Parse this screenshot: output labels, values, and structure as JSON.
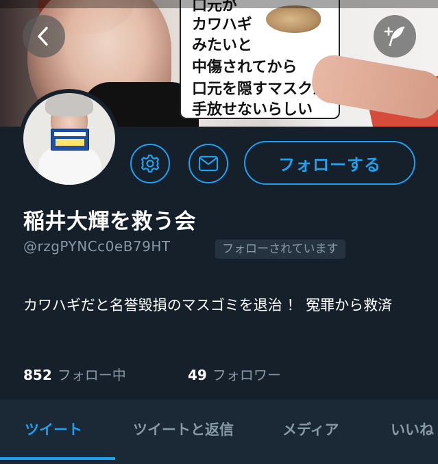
{
  "header": {
    "banner_text_lines": [
      "口元が",
      "カワハギ",
      "みたいと",
      "中傷されてから",
      "口元を隠すマスクが",
      "手放せないらしい"
    ]
  },
  "avatar": {
    "sign_text": "ミスター東大 稲井大輝"
  },
  "profile": {
    "name": "稲井大輝を救う会",
    "handle": "@rzgPYNCc0eB79HT",
    "follows_you_badge": "フォローされています",
    "bio": "カワハギだと名誉毀損のマスゴミを退治 ！ 冤罪から救済",
    "following_count": "852",
    "following_label": "フォロー中",
    "followers_count": "49",
    "followers_label": "フォロワー"
  },
  "actions": {
    "follow_label": "フォローする"
  },
  "tabs": [
    {
      "label": "ツイート",
      "active": true
    },
    {
      "label": "ツイートと返信",
      "active": false
    },
    {
      "label": "メディア",
      "active": false
    },
    {
      "label": "いいね",
      "active": false
    }
  ],
  "colors": {
    "background": "#15202b",
    "accent": "#1da1f2",
    "secondary_text": "#8899a6"
  }
}
